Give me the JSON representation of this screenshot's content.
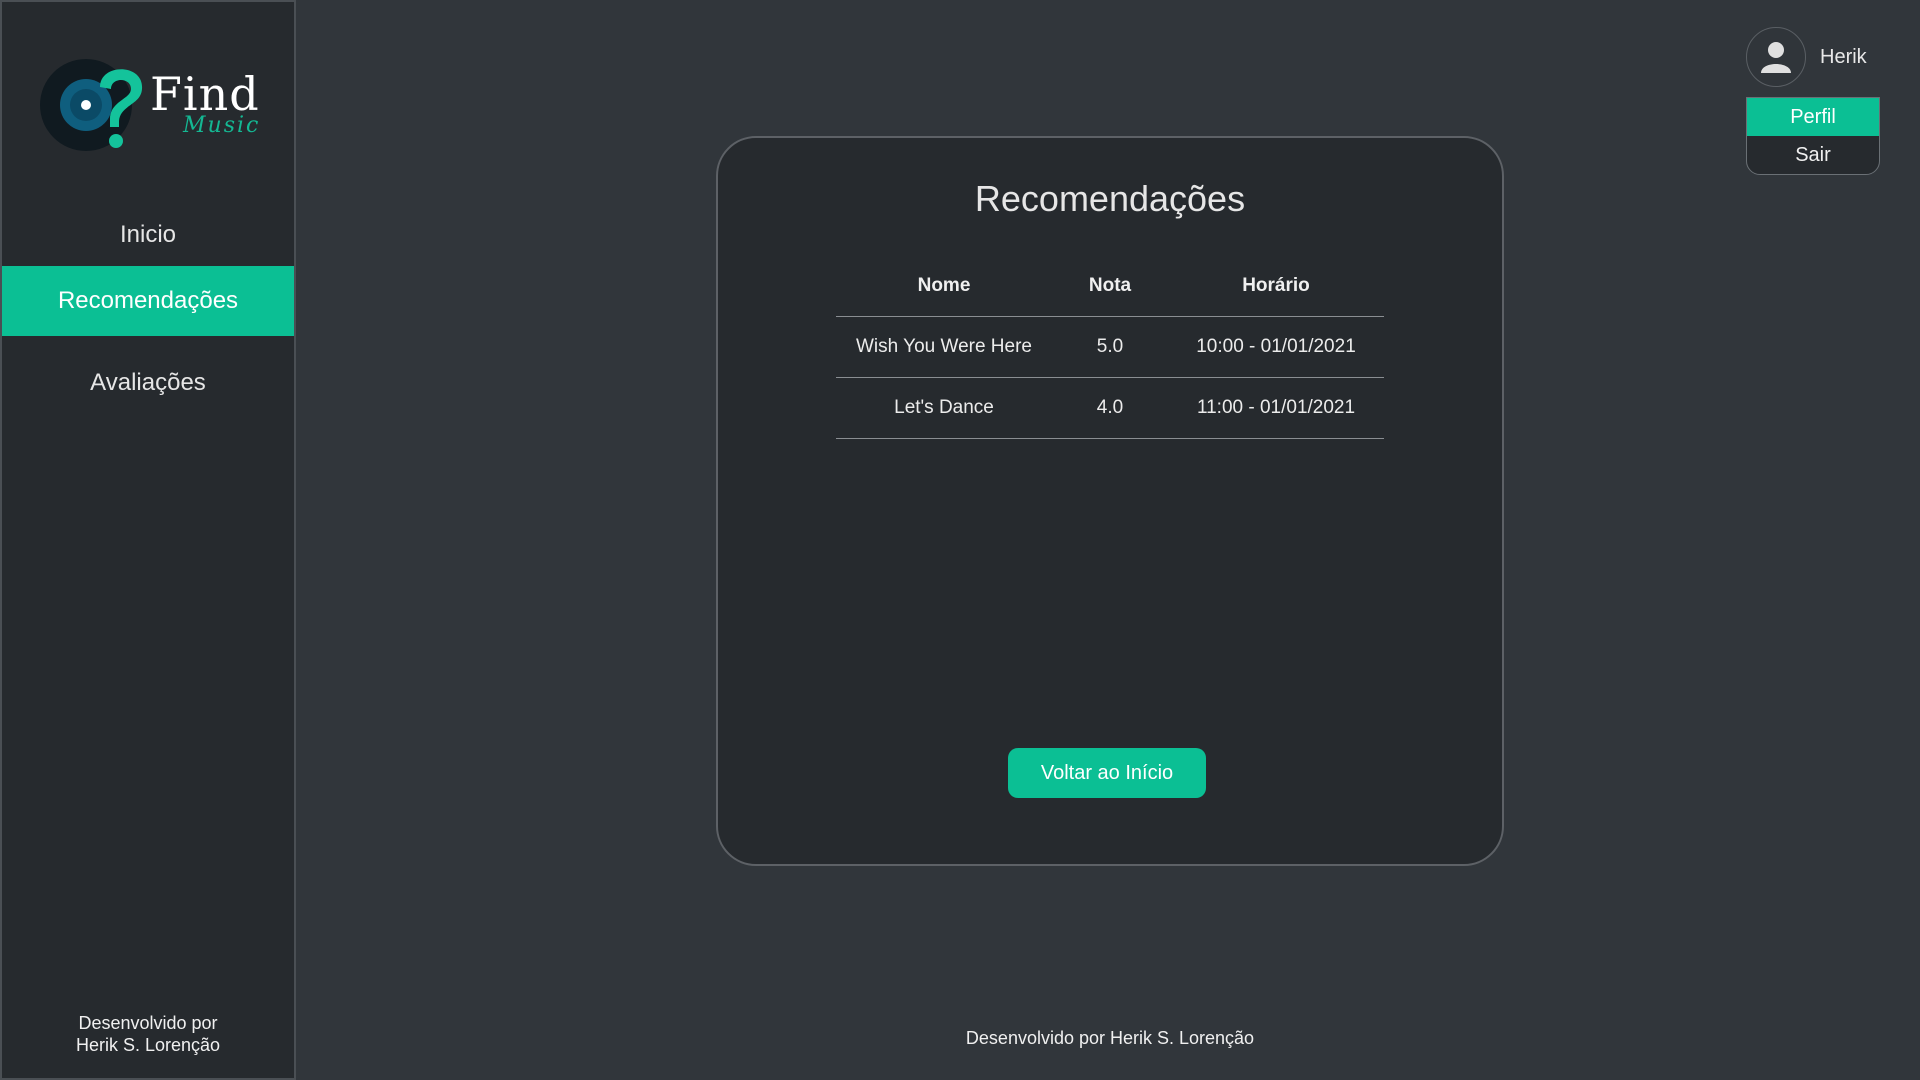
{
  "brand": {
    "name": "Find",
    "tagline": "Music"
  },
  "sidebar": {
    "items": [
      {
        "label": "Inicio"
      },
      {
        "label": "Recomendações"
      },
      {
        "label": "Avaliações"
      }
    ],
    "footer_line1": "Desenvolvido por",
    "footer_line2": "Herik S. Lorenção"
  },
  "user": {
    "name": "Herik",
    "menu": [
      {
        "label": "Perfil"
      },
      {
        "label": "Sair"
      }
    ]
  },
  "main": {
    "title": "Recomendações",
    "table": {
      "headers": [
        "Nome",
        "Nota",
        "Horário"
      ],
      "rows": [
        [
          "Wish You Were Here",
          "5.0",
          "10:00 - 01/01/2021"
        ],
        [
          "Let's Dance",
          "4.0",
          "11:00 - 01/01/2021"
        ]
      ]
    },
    "back_button": "Voltar ao Início",
    "footer": "Desenvolvido por Herik S. Lorenção"
  },
  "colors": {
    "accent": "#0bbf94",
    "background": "#31363b",
    "panel": "#262a2e"
  },
  "icons": {
    "avatar": "user-icon",
    "logo": "vinyl-question-icon"
  }
}
